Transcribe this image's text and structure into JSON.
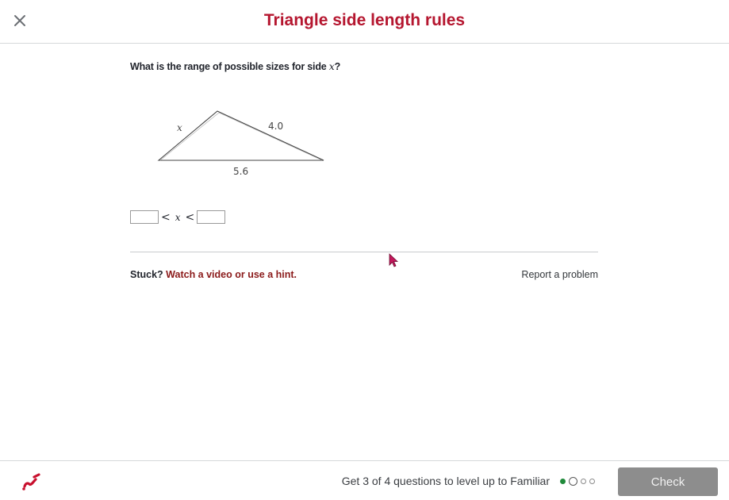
{
  "header": {
    "close_icon": "close-icon",
    "title": "Triangle side length rules"
  },
  "question": {
    "prefix": "What is the range of possible sizes for side ",
    "variable": "x",
    "suffix": "?"
  },
  "figure": {
    "label_left_side": "x",
    "label_right_side": "4.0",
    "label_base": "5.6"
  },
  "answer": {
    "lower_value": "",
    "upper_value": "",
    "less_than_1": "<",
    "variable": "x",
    "less_than_2": "<"
  },
  "help": {
    "stuck_label": "Stuck?",
    "hint_link": "Watch a video or use a hint.",
    "report_link": "Report a problem"
  },
  "footer": {
    "logo_icon": "khan-academy-logo-icon",
    "progress_text": "Get 3 of 4 questions to level up to Familiar",
    "progress_dots": [
      "completed",
      "current",
      "pending",
      "pending"
    ],
    "check_label": "Check"
  },
  "colors": {
    "title": "#b5162f",
    "hint_link": "#8b1a1a",
    "dot_completed": "#1f8a3a",
    "check_button_bg": "#8d8d8d",
    "cursor": "#c2185b"
  }
}
